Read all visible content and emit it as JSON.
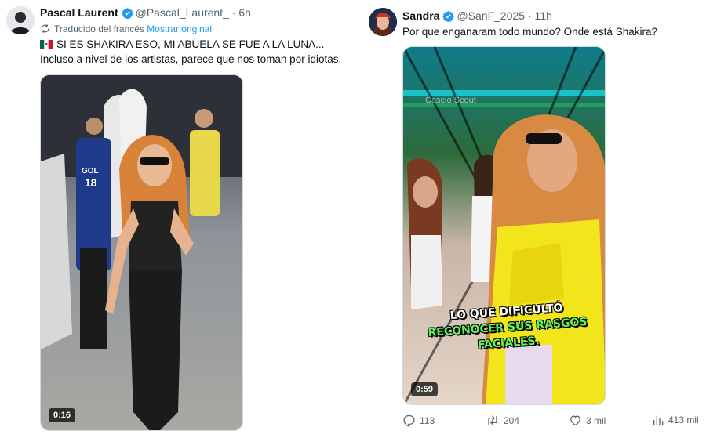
{
  "tweet_left": {
    "author_name": "Pascal Laurent",
    "handle": "@Pascal_Laurent_",
    "separator": "·",
    "time": "6h",
    "translated_label": "Traducido del francés",
    "show_original": "Mostrar original",
    "line1": "SI ES SHAKIRA ESO, MI ABUELA SE FUE A LA LUNA...",
    "line2": "Incluso a nivel de los artistas, parece que nos toman por idiotas.",
    "video_duration": "0:16"
  },
  "tweet_right": {
    "author_name": "Sandra",
    "handle": "@SanF_2025",
    "separator": "·",
    "time": "11h",
    "text": "Por que enganaram todo mundo? Onde está Shakira?",
    "video_duration": "0:59",
    "watermark": "Cascio Scout",
    "caption_line1": "LO QUE DIFICULTÓ",
    "caption_line2": "RECONOCER SUS RASGOS",
    "caption_line3": "FACIALES.",
    "actions": {
      "replies": "113",
      "reposts": "204",
      "likes": "3 mil",
      "views": "413 mil"
    }
  },
  "colors": {
    "verified": "#1d9bf0",
    "link": "#1d9bf0",
    "secondary_text": "#536471",
    "caption_green": "#5ef45e",
    "outfit_yellow": "#f2e51c"
  },
  "icons": [
    "verified-badge-icon",
    "translate-icon",
    "mexico-flag-icon",
    "reply-icon",
    "repost-icon",
    "like-icon",
    "views-icon"
  ]
}
